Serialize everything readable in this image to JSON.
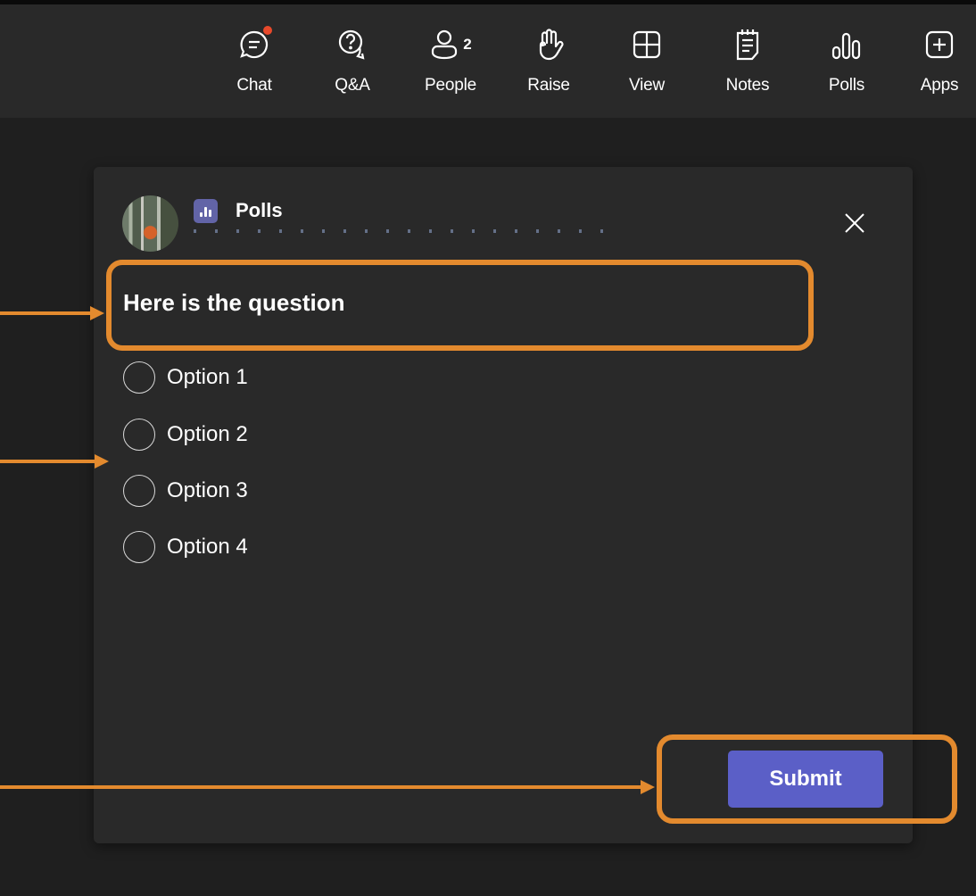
{
  "toolbar": {
    "items": [
      {
        "label": "Chat",
        "icon": "chat-icon",
        "has_notification": true
      },
      {
        "label": "Q&A",
        "icon": "qa-icon"
      },
      {
        "label": "People",
        "icon": "people-icon",
        "count": "2"
      },
      {
        "label": "Raise",
        "icon": "raise-hand-icon"
      },
      {
        "label": "View",
        "icon": "view-grid-icon"
      },
      {
        "label": "Notes",
        "icon": "notes-icon"
      },
      {
        "label": "Polls",
        "icon": "polls-icon"
      },
      {
        "label": "Apps",
        "icon": "apps-icon"
      }
    ]
  },
  "poll": {
    "app_name": "Polls",
    "question": "Here is the question",
    "options": [
      "Option 1",
      "Option 2",
      "Option 3",
      "Option 4"
    ],
    "submit_label": "Submit"
  },
  "colors": {
    "background": "#1f1f1f",
    "toolbar": "#292929",
    "panel": "#292929",
    "accent": "#5b5fc7",
    "highlight": "#e38a2e",
    "notification": "#e8492b"
  }
}
